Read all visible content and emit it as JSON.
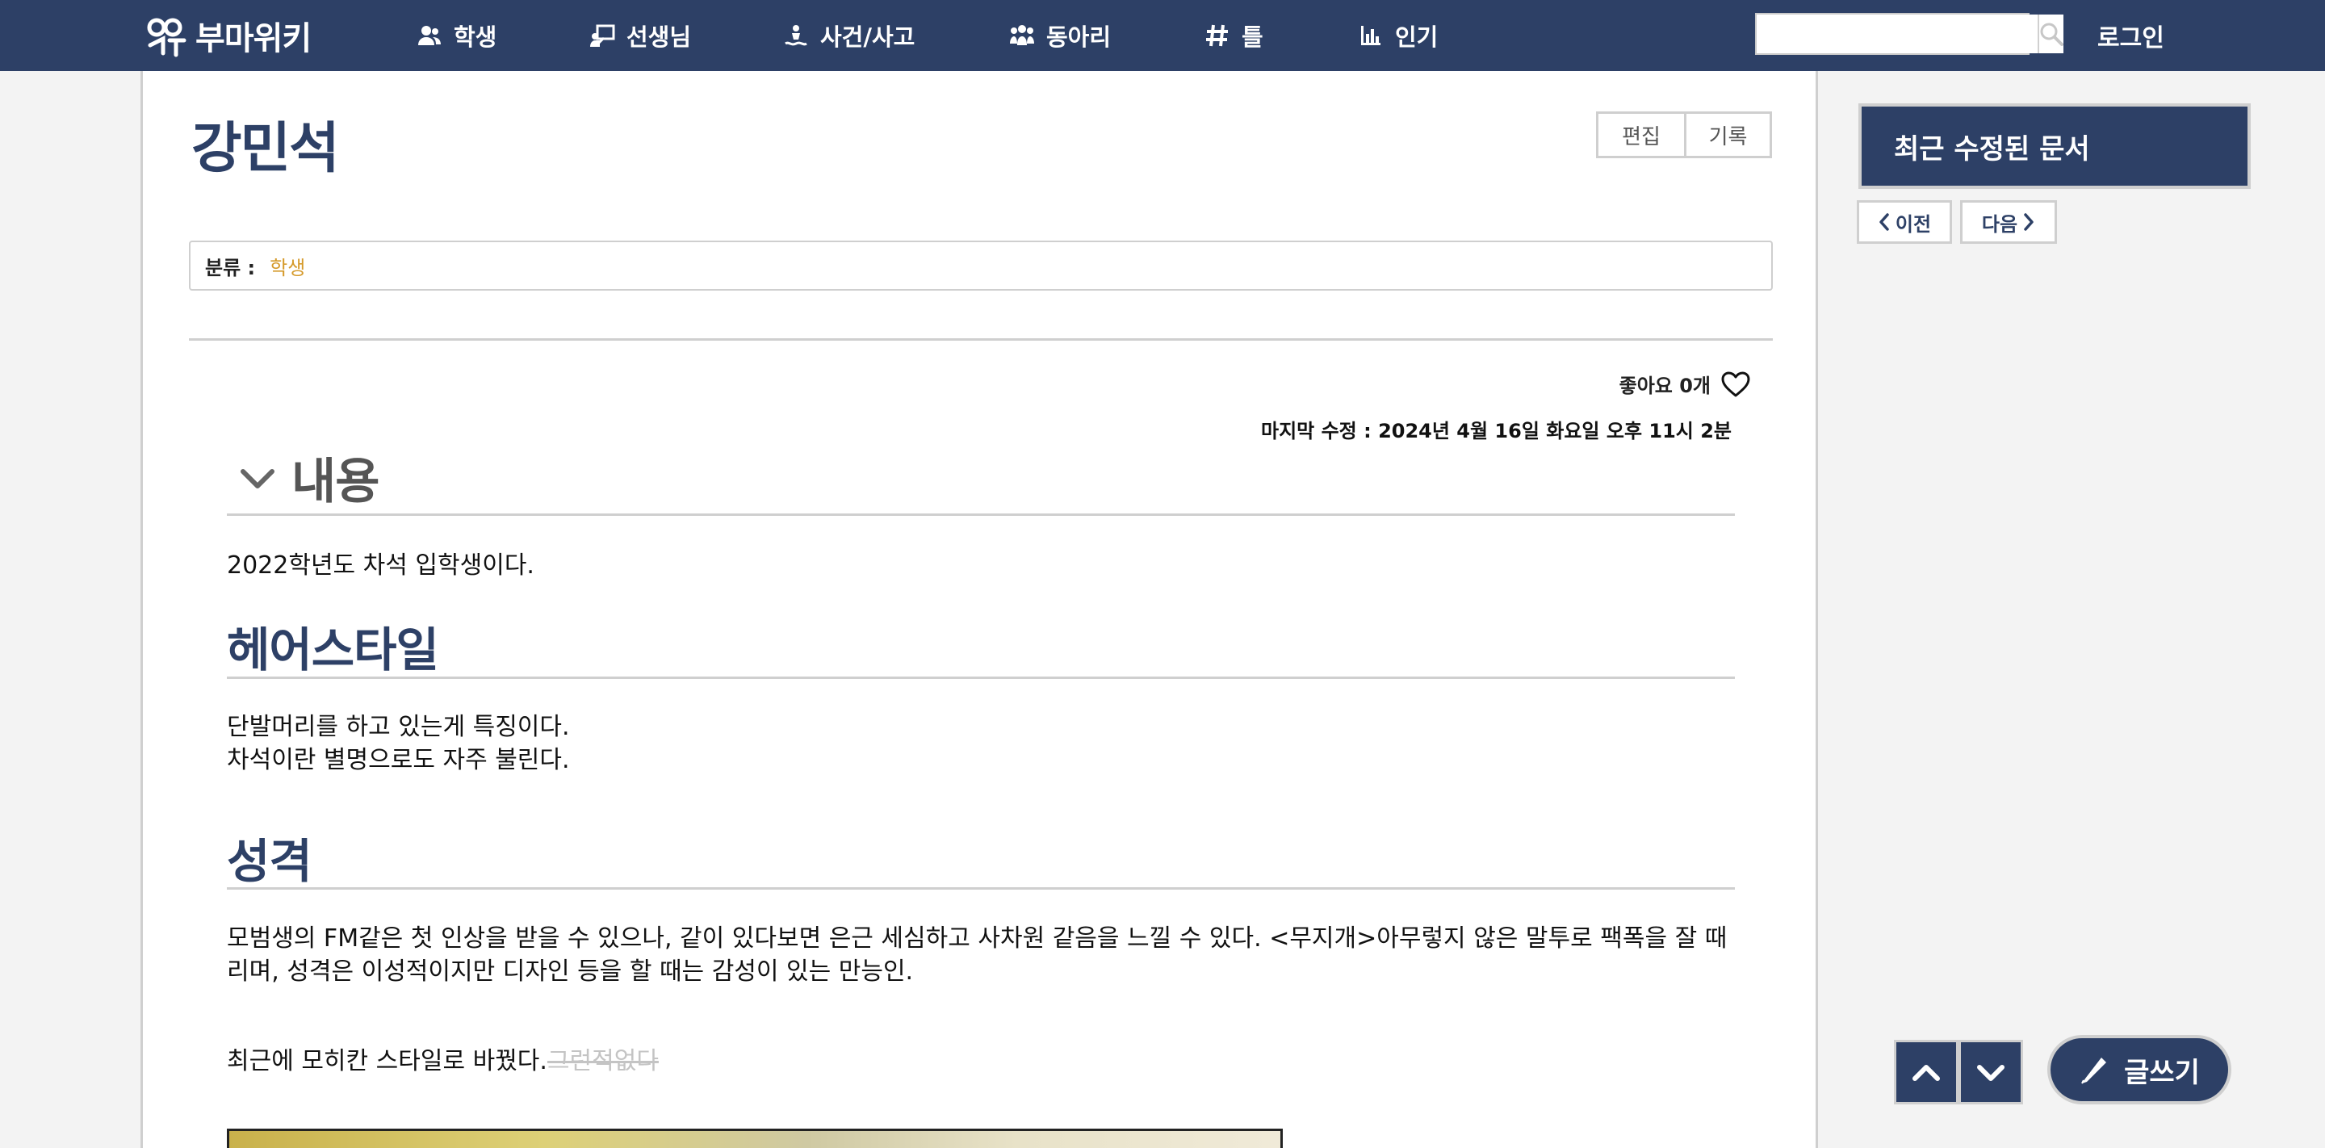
{
  "header": {
    "logo_text": "부마위키",
    "nav": [
      {
        "label": "학생",
        "icon": "users-icon"
      },
      {
        "label": "선생님",
        "icon": "chalkboard-teacher-icon"
      },
      {
        "label": "사건/사고",
        "icon": "person-drowning-icon"
      },
      {
        "label": "동아리",
        "icon": "people-group-icon"
      },
      {
        "label": "틀",
        "icon": "hashtag-icon"
      },
      {
        "label": "인기",
        "icon": "bar-chart-icon"
      }
    ],
    "search_placeholder": "",
    "search_icon": "search-icon",
    "login_label": "로그인"
  },
  "article": {
    "title": "강민석",
    "edit_label": "편집",
    "history_label": "기록",
    "category_label": "분류 :",
    "category_value": "학생",
    "likes_text": "좋아요 0개",
    "last_modified": "마지막 수정 : 2024년 4월 16일 화요일 오후 11시 2분",
    "section_title": "내용",
    "intro": "2022학년도 차석 입학생이다.",
    "sections": [
      {
        "title": "헤어스타일",
        "lines": [
          "단발머리를 하고 있는게 특징이다.",
          "차석이란 별명으로도 자주 불린다."
        ]
      },
      {
        "title": "성격",
        "lines": [
          "모범생의 FM같은 첫 인상을 받을 수 있으나, 같이 있다보면 은근 세심하고 사차원 같음을 느낄 수 있다. <무지개>아무렇지 않은 말투로 팩폭을 잘 때리며, 성격은 이성적이지만 디자인 등을 할 때는 감성이 있는 만능인."
        ],
        "extra_text": "최근에 모히칸 스타일로 바꿨다.",
        "extra_strike": "그런적없다"
      }
    ]
  },
  "sidebar": {
    "recent_title": "최근 수정된 문서",
    "prev_label": "이전",
    "next_label": "다음"
  },
  "floating": {
    "write_label": "글쓰기"
  },
  "colors": {
    "brand": "#2d4066",
    "category_link": "#d59a2b",
    "border": "#cfcfcf"
  }
}
